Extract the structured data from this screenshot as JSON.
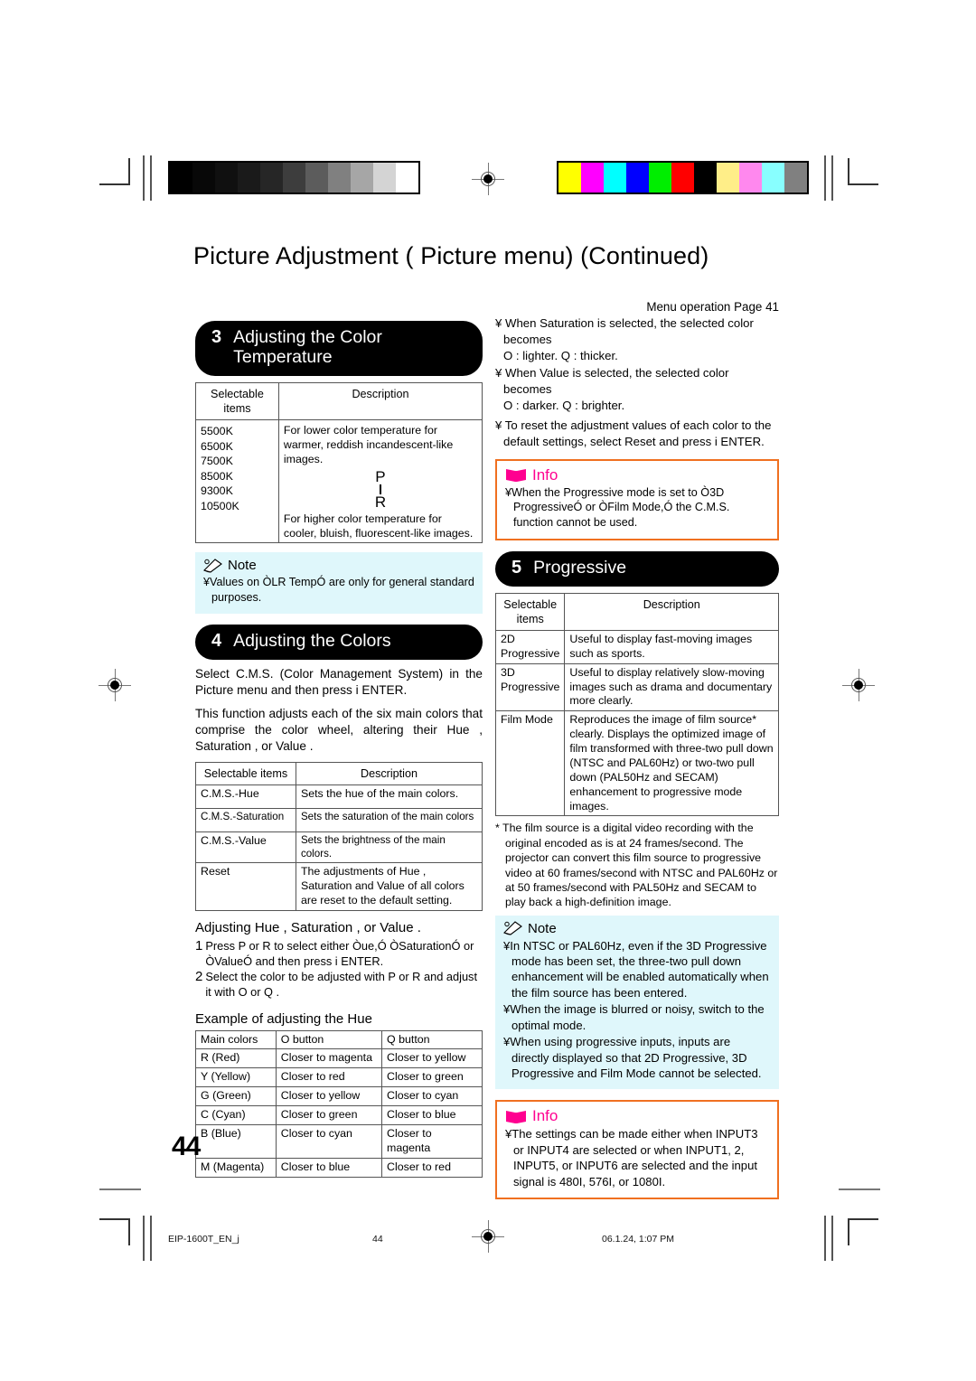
{
  "document": {
    "title": "Picture Adjustment ( Picture  menu) (Continued)",
    "page_number": "44",
    "footer": {
      "file": "EIP-1600T_EN_j",
      "page": "44",
      "timestamp": "06.1.24, 1:07 PM"
    }
  },
  "left_column": {
    "section3": {
      "number": "3",
      "title": "Adjusting the Color Temperature",
      "table": {
        "headers": [
          "Selectable items",
          "Description"
        ],
        "items": "5500K\n6500K\n7500K\n8500K\n9300K\n10500K",
        "desc_top": "For lower color temperature for warmer, reddish incandescent-like images.",
        "desc_bottom": "For higher color temperature for cooler, bluish, fluorescent-like images.",
        "arrow_up": "P",
        "arrow_down": "R"
      }
    },
    "note1": {
      "label": "Note",
      "bullets": [
        "¥Values on ÒLR TempÓ are only for general standard purposes."
      ]
    },
    "section4": {
      "number": "4",
      "title": "Adjusting the Colors",
      "para1": "Select  C.M.S.  (Color Management System) in the  Picture  menu and then press i    ENTER.",
      "para2": "This function adjusts each of the six main colors that comprise the color wheel, altering their  Hue ,  Saturation , or  Value .",
      "table": {
        "headers": [
          "Selectable items",
          "Description"
        ],
        "rows": [
          [
            "C.M.S.-Hue",
            "Sets the hue of the main colors."
          ],
          [
            "C.M.S.-Saturation",
            "Sets the saturation of the main colors"
          ],
          [
            "C.M.S.-Value",
            "Sets the brightness of the main colors."
          ],
          [
            "Reset",
            "The adjustments of  Hue ,  Saturation  and  Value  of all colors are reset to the default setting."
          ]
        ]
      },
      "subhead": "Adjusting  Hue ,  Saturation , or  Value .",
      "steps": [
        {
          "n": "1",
          "text": "Press P  or R  to select either Òue,Ó ÒSaturationÓ or ÒValueÓ and then press   i    ENTER."
        },
        {
          "n": "2",
          "text": "Select the color to be adjusted with  P  or R  and adjust it with O  or Q ."
        }
      ],
      "example_head": "Example of adjusting the  Hue",
      "example_table": {
        "headers": [
          "Main colors",
          "O button",
          "Q button"
        ],
        "rows": [
          [
            "R (Red)",
            "Closer to magenta",
            "Closer to yellow"
          ],
          [
            "Y (Yellow)",
            "Closer to red",
            "Closer to green"
          ],
          [
            "G (Green)",
            "Closer to yellow",
            "Closer to cyan"
          ],
          [
            "C (Cyan)",
            "Closer to green",
            "Closer to blue"
          ],
          [
            "B (Blue)",
            "Closer to cyan",
            "Closer to magenta"
          ],
          [
            "M (Magenta)",
            "Closer to blue",
            "Closer to red"
          ]
        ]
      }
    }
  },
  "right_column": {
    "menu_operation": "Menu operation     Page 41",
    "bullets": [
      "¥ When  Saturation  is selected, the selected color becomes",
      "O : lighter.  Q : thicker.",
      "¥ When  Value  is selected, the selected color becomes",
      "O : darker.  Q : brighter.",
      "¥ To reset the adjustment values of each color to the default settings, select  Reset  and press i     ENTER."
    ],
    "info1": {
      "label": "Info",
      "text": "¥When  the Progressive mode is set to Ò3D ProgressiveÓ or ÒFilm Mode,Ó the C.M.S. function cannot be used."
    },
    "section5": {
      "number": "5",
      "title": "Progressive",
      "table": {
        "headers": [
          "Selectable items",
          "Description"
        ],
        "rows": [
          [
            "2D Progressive",
            "Useful to display fast-moving images such as sports."
          ],
          [
            "3D Progressive",
            "Useful to display relatively slow-moving images such as drama and documentary more clearly."
          ],
          [
            "Film Mode",
            "Reproduces the image of film source* clearly. Displays the optimized image of film transformed with three-two pull down (NTSC and PAL60Hz) or two-two pull down (PAL50Hz and SECAM) enhancement to progressive mode images."
          ]
        ]
      },
      "footnote": "* The film source is a digital video recording with the original encoded as is at 24 frames/second. The projector can convert this film source to progressive video at 60 frames/second with NTSC and PAL60Hz or at 50 frames/second with PAL50Hz and SECAM to play back a high-definition image."
    },
    "note2": {
      "label": "Note",
      "bullets": [
        "¥In NTSC or PAL60Hz, even if the 3D Progressive mode has been set, the three-two pull down enhancement will be enabled automatically when the film source has been entered.",
        "¥When the image is blurred or noisy, switch to the optimal mode.",
        "¥When using progressive inputs, inputs are directly displayed so that 2D Progressive, 3D Progressive and Film Mode cannot be selected."
      ]
    },
    "info2": {
      "label": "Info",
      "text": "¥The settings can be made either when INPUT3 or INPUT4 are selected or when INPUT1, 2, INPUT5, or INPUT6 are selected and the input signal is 480I, 576I, or 1080I."
    }
  },
  "print_marks": {
    "grayscale_swatches": [
      "#000000",
      "#080808",
      "#101010",
      "#1a1a1a",
      "#262626",
      "#3d3d3d",
      "#5c5c5c",
      "#808080",
      "#a6a6a6",
      "#d4d4d4",
      "#ffffff"
    ],
    "color_swatches": [
      "#ffff00",
      "#ff00ff",
      "#00ffff",
      "#0000ff",
      "#00ee00",
      "#ff0000",
      "#000000",
      "#ffee88",
      "#ff88ee",
      "#88ffff",
      "#808080"
    ]
  }
}
